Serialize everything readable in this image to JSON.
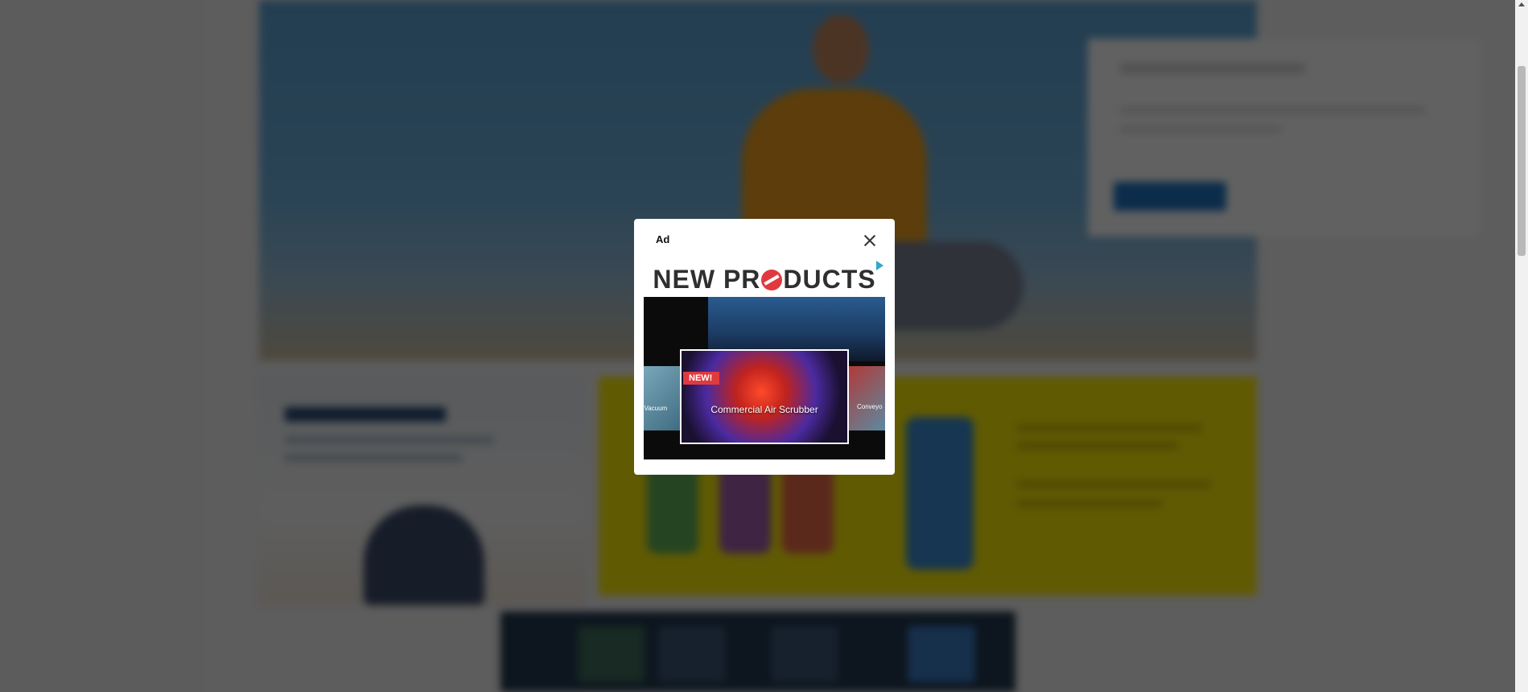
{
  "background": {
    "description_hidden": true
  },
  "ad": {
    "label": "Ad",
    "close_icon": "close-icon",
    "headline_part1": "NEW PR",
    "headline_part2": "DUCTS",
    "adchoices_icon": "adchoices-triangle-icon",
    "feature": {
      "badge": "NEW!",
      "caption": "Commercial Air Scrubber"
    },
    "side_left_caption": "al Vacuum",
    "side_right_caption": "Conveyo",
    "colors": {
      "accent_red": "#e03a3e",
      "headline": "#2f2f2f"
    }
  },
  "overlay": {
    "color": "#000000",
    "opacity": 0.62
  }
}
